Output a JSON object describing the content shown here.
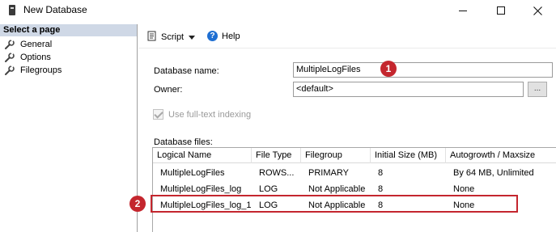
{
  "window": {
    "title": "New Database"
  },
  "left_pane": {
    "header": "Select a page",
    "pages": [
      {
        "label": "General"
      },
      {
        "label": "Options"
      },
      {
        "label": "Filegroups"
      }
    ]
  },
  "toolbar": {
    "script_label": "Script",
    "help_label": "Help",
    "help_icon_glyph": "?"
  },
  "form": {
    "db_name_label": "Database name:",
    "db_name_value": "MultipleLogFiles",
    "owner_label": "Owner:",
    "owner_value": "<default>",
    "owner_browse": "...",
    "fulltext_label": "Use full-text indexing",
    "fulltext_checked": true,
    "db_files_label": "Database files:"
  },
  "grid": {
    "columns": [
      "Logical Name",
      "File Type",
      "Filegroup",
      "Initial Size (MB)",
      "Autogrowth / Maxsize"
    ],
    "rows": [
      {
        "logical_name": "MultipleLogFiles",
        "file_type": "ROWS...",
        "filegroup": "PRIMARY",
        "initial_size": "8",
        "autogrowth": "By 64 MB, Unlimited"
      },
      {
        "logical_name": "MultipleLogFiles_log",
        "file_type": "LOG",
        "filegroup": "Not Applicable",
        "initial_size": "8",
        "autogrowth": "None"
      },
      {
        "logical_name": "MultipleLogFiles_log_1",
        "file_type": "LOG",
        "filegroup": "Not Applicable",
        "initial_size": "8",
        "autogrowth": "None"
      }
    ]
  },
  "callouts": {
    "one": "1",
    "two": "2"
  },
  "colors": {
    "callout_red": "#c4262e",
    "header_blue": "#cfd8e6",
    "help_blue": "#1f6fd2"
  },
  "icons": {
    "app": "server-icon",
    "page": "wrench-icon",
    "script": "script-icon",
    "help": "help-icon"
  }
}
